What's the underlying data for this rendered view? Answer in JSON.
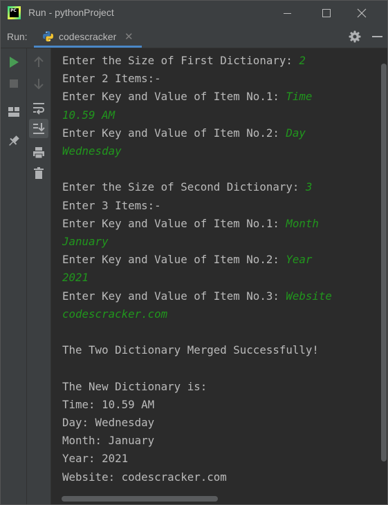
{
  "window": {
    "title": "Run - pythonProject",
    "logo_text": "PC"
  },
  "runbar": {
    "label": "Run:",
    "tab_label": "codescracker"
  },
  "console": {
    "lines": [
      [
        {
          "t": "Enter the Size of First Dictionary: "
        },
        {
          "t": "2",
          "input": true
        }
      ],
      [
        {
          "t": "Enter 2 Items:-"
        }
      ],
      [
        {
          "t": "Enter Key and Value of Item No.1: "
        },
        {
          "t": "Time",
          "input": true
        }
      ],
      [
        {
          "t": "10.59 AM",
          "input": true
        }
      ],
      [
        {
          "t": "Enter Key and Value of Item No.2: "
        },
        {
          "t": "Day",
          "input": true
        }
      ],
      [
        {
          "t": "Wednesday",
          "input": true
        }
      ],
      [],
      [
        {
          "t": "Enter the Size of Second Dictionary: "
        },
        {
          "t": "3",
          "input": true
        }
      ],
      [
        {
          "t": "Enter 3 Items:-"
        }
      ],
      [
        {
          "t": "Enter Key and Value of Item No.1: "
        },
        {
          "t": "Month",
          "input": true
        }
      ],
      [
        {
          "t": "January",
          "input": true
        }
      ],
      [
        {
          "t": "Enter Key and Value of Item No.2: "
        },
        {
          "t": "Year",
          "input": true
        }
      ],
      [
        {
          "t": "2021",
          "input": true
        }
      ],
      [
        {
          "t": "Enter Key and Value of Item No.3: "
        },
        {
          "t": "Website",
          "input": true
        }
      ],
      [
        {
          "t": "codescracker.com",
          "input": true
        }
      ],
      [],
      [
        {
          "t": "The Two Dictionary Merged Successfully!"
        }
      ],
      [],
      [
        {
          "t": "The New Dictionary is:"
        }
      ],
      [
        {
          "t": "Time: 10.59 AM"
        }
      ],
      [
        {
          "t": "Day: Wednesday"
        }
      ],
      [
        {
          "t": "Month: January"
        }
      ],
      [
        {
          "t": "Year: 2021"
        }
      ],
      [
        {
          "t": "Website: codescracker.com"
        }
      ]
    ]
  },
  "icons": {
    "titlebar": [
      "pycharm-logo-icon",
      "minimize-icon",
      "maximize-icon",
      "close-icon"
    ],
    "runbar": [
      "python-file-icon",
      "close-tab-icon",
      "gear-icon",
      "hide-icon"
    ],
    "gutter_left": [
      "run-icon",
      "stop-icon",
      "layout-icon",
      "pin-icon"
    ],
    "gutter_right": [
      "up-arrow-icon",
      "down-arrow-icon",
      "soft-wrap-icon",
      "scroll-to-end-icon",
      "print-icon",
      "trash-icon"
    ]
  },
  "colors": {
    "background": "#2b2b2b",
    "panel": "#3c3f41",
    "text": "#bbbbbb",
    "user_input": "#21961d",
    "run_green": "#499c54",
    "tab_underline": "#4a88c7"
  }
}
